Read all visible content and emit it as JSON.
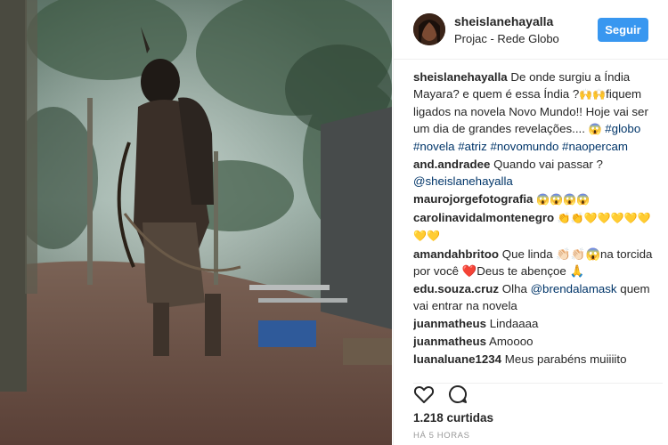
{
  "post": {
    "username": "sheislanehayalla",
    "location": "Projac - Rede Globo",
    "follow_label": "Seguir",
    "likes": "1.218 curtidas",
    "time": "HÁ 5 HORAS"
  },
  "caption": {
    "user": "sheislanehayalla",
    "text": "De onde surgiu a Índia Mayara? e quem é essa Índia ?",
    "emoji1": "🙌🙌",
    "text2": "fiquem ligados na novela Novo Mundo!! Hoje vai ser um dia de grandes revelações....",
    "emoji2": "😱",
    "hashtags": "#globo #novela #atriz #novomundo #naopercam"
  },
  "comments": [
    {
      "user": "and.andradee",
      "text": "Quando vai passar ?",
      "mention": "@sheislanehayalla"
    },
    {
      "user": "maurojorgefotografia",
      "text": "😱😱😱😱"
    },
    {
      "user": "carolinavidalmontenegro",
      "text": "👏👏💛💛💛💛💛💛💛"
    },
    {
      "user": "amandahbritoo",
      "text": "Que linda 👏🏻👏🏻😱na torcida por você ❤️Deus te abençoe 🙏"
    },
    {
      "user": "edu.souza.cruz",
      "text": "Olha",
      "mention": "@brendalamask",
      "text2": "quem vai entrar na novela"
    },
    {
      "user": "juanmatheus",
      "text": "Lindaaaa"
    },
    {
      "user": "juanmatheus",
      "text": "Amoooo"
    },
    {
      "user": "luanaluane1234",
      "text": "Meus parabéns muiiiito"
    }
  ],
  "icons": [
    "heart-icon",
    "comment-icon"
  ]
}
